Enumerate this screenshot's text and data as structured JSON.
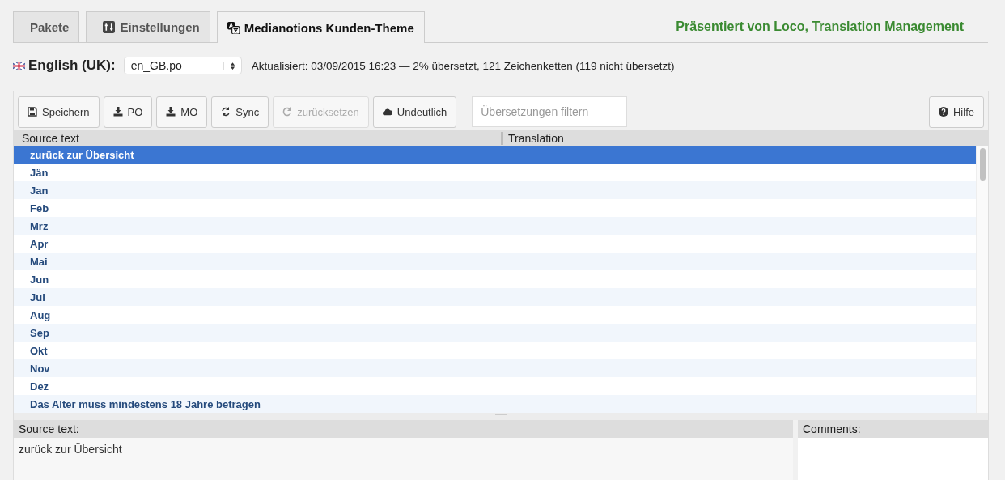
{
  "tabs": [
    {
      "label": "Pakete",
      "kind": "plain",
      "selected": false
    },
    {
      "label": "Einstellungen",
      "kind": "sliders",
      "selected": false
    },
    {
      "label": "Medianotions Kunden-Theme",
      "kind": "translate",
      "selected": true
    }
  ],
  "credit": "Präsentiert von Loco, Translation Management",
  "locale": {
    "label": "English (UK):",
    "file": "en_GB.po",
    "status": "Aktualisiert: 03/09/2015 16:23 — 2% übersetzt, 121 Zeichenketten (119 nicht übersetzt)"
  },
  "toolbar": {
    "buttons": [
      {
        "label": "Speichern",
        "kind": "save",
        "disabled": false
      },
      {
        "label": "PO",
        "kind": "download",
        "disabled": false
      },
      {
        "label": "MO",
        "kind": "download",
        "disabled": false
      },
      {
        "label": "Sync",
        "kind": "sync",
        "disabled": false
      },
      {
        "label": "zurücksetzen",
        "kind": "revert",
        "disabled": true
      },
      {
        "label": "Undeutlich",
        "kind": "cloud",
        "disabled": false
      }
    ],
    "filter": {
      "placeholder": "Übersetzungen filtern"
    },
    "help": {
      "label": "Hilfe"
    }
  },
  "table": {
    "columns": [
      "Source text",
      "Translation"
    ],
    "rows": [
      {
        "source": "zurück zur Übersicht",
        "selected": true
      },
      {
        "source": "Jän",
        "selected": false
      },
      {
        "source": "Jan",
        "selected": false
      },
      {
        "source": "Feb",
        "selected": false
      },
      {
        "source": "Mrz",
        "selected": false
      },
      {
        "source": "Apr",
        "selected": false
      },
      {
        "source": "Mai",
        "selected": false
      },
      {
        "source": "Jun",
        "selected": false
      },
      {
        "source": "Jul",
        "selected": false
      },
      {
        "source": "Aug",
        "selected": false
      },
      {
        "source": "Sep",
        "selected": false
      },
      {
        "source": "Okt",
        "selected": false
      },
      {
        "source": "Nov",
        "selected": false
      },
      {
        "source": "Dez",
        "selected": false
      },
      {
        "source": "Das Alter muss mindestens 18 Jahre betragen",
        "selected": false
      }
    ]
  },
  "source_panel": {
    "heading": "Source text:",
    "text": "zurück zur Übersicht"
  },
  "comments_panel": {
    "heading": "Comments:"
  }
}
